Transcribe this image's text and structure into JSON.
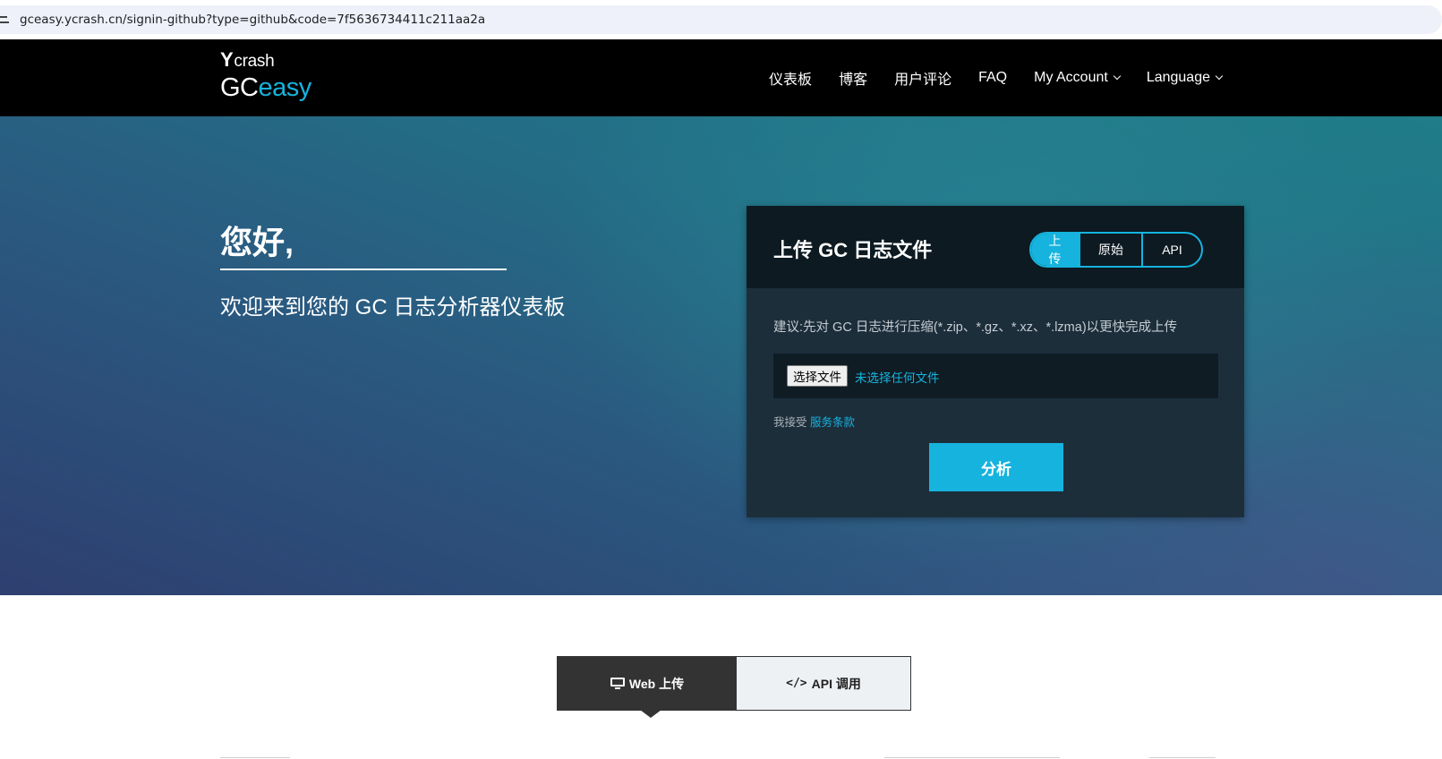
{
  "browser": {
    "url": "gceasy.ycrash.cn/signin-github?type=github&code=7f5636734411c211aa2a"
  },
  "header": {
    "logo_top": "crash",
    "logo_top_prefix": "Y",
    "logo_bottom_gc": "GC",
    "logo_bottom_easy": "easy",
    "nav": {
      "dashboard": "仪表板",
      "blog": "博客",
      "reviews": "用户评论",
      "faq": "FAQ",
      "account": "My Account",
      "language": "Language"
    }
  },
  "hero": {
    "greeting": "您好,",
    "welcome": "欢迎来到您的 GC 日志分析器仪表板"
  },
  "upload_panel": {
    "title": "上传 GC 日志文件",
    "mode_options": {
      "upload_line1": "上",
      "upload_line2": "传",
      "raw": "原始",
      "api": "API"
    },
    "selected_mode": "上传",
    "hint": "建议:先对 GC 日志进行压缩(*.zip、*.gz、*.xz、*.lzma)以更快完成上传",
    "file_button": "选择文件",
    "file_status": "未选择任何文件",
    "terms_prefix": "我接受",
    "terms_link": "服务条款",
    "analyze_button": "分析"
  },
  "tabs": {
    "web": "Web 上传",
    "api": "API 调用"
  },
  "colors": {
    "accent": "#16b3de",
    "header_bg": "#000000",
    "panel_bg": "#1d2e3b"
  }
}
